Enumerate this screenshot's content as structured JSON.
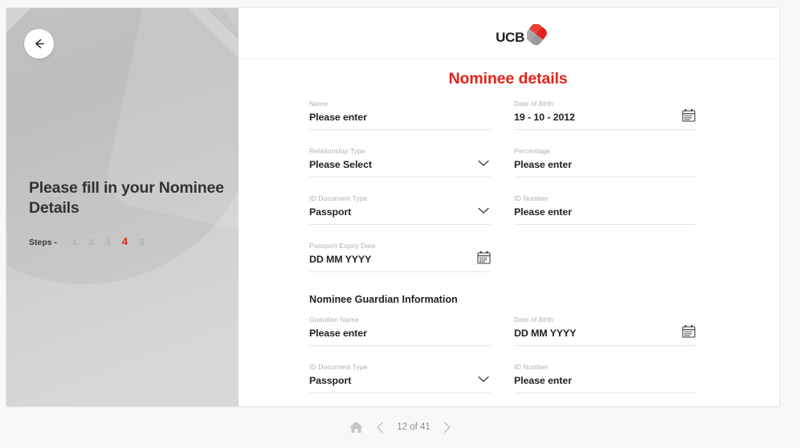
{
  "brand": {
    "logo_text": "UCB",
    "accent_color": "#e2231a",
    "logo_mark_red": "#e2231a",
    "logo_mark_gray": "#9a9a9a"
  },
  "hero": {
    "back_icon": "arrow-left-icon",
    "title": "Please fill in your Nominee Details",
    "steps_label": "Steps -",
    "steps": [
      "1",
      "2",
      "3",
      "4",
      "5"
    ],
    "active_step": "4"
  },
  "main": {
    "page_title": "Nominee details",
    "section_heading": "Nominee Guardian Information"
  },
  "form": {
    "name": {
      "label": "Name",
      "value": "Please enter"
    },
    "date_of_birth": {
      "label": "Date of Birth",
      "value": "19 - 10 - 2012",
      "icon": "calendar-icon"
    },
    "relationship_type": {
      "label": "Relationship Type",
      "value": "Please Select",
      "icon": "chevron-down-icon"
    },
    "percentage": {
      "label": "Percentage",
      "value": "Please enter"
    },
    "id_document_type": {
      "label": "ID Document Type",
      "value": "Passport",
      "icon": "chevron-down-icon"
    },
    "id_number": {
      "label": "ID Number",
      "value": "Please enter"
    },
    "passport_expiry_date": {
      "label": "Passport Expiry Date",
      "value": "DD MM YYYY",
      "icon": "calendar-icon"
    },
    "guardian_name": {
      "label": "Guardian Name",
      "value": "Please enter"
    },
    "guardian_date_of_birth": {
      "label": "Date of Birth",
      "value": "DD MM YYYY",
      "icon": "calendar-icon"
    },
    "guardian_id_document_type": {
      "label": "ID Document Type",
      "value": "Passport",
      "icon": "chevron-down-icon"
    },
    "guardian_id_number": {
      "label": "ID Number",
      "value": "Please enter"
    }
  },
  "footer": {
    "home_icon": "home-icon",
    "prev_icon": "chevron-left-icon",
    "next_icon": "chevron-right-icon",
    "page_indicator": "12 of 41"
  }
}
